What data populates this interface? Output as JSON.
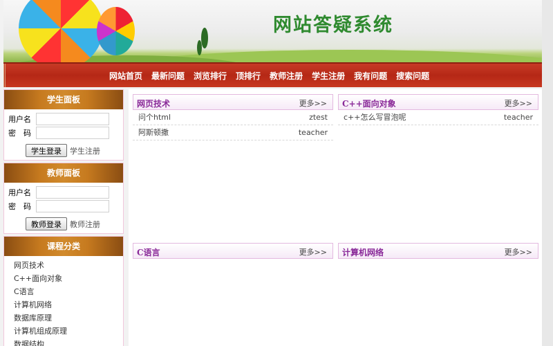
{
  "banner": {
    "title": "网站答疑系统"
  },
  "nav": {
    "items": [
      "网站首页",
      "最新问题",
      "浏览排行",
      "顶排行",
      "教师注册",
      "学生注册",
      "我有问题",
      "搜索问题"
    ]
  },
  "student_panel": {
    "title": "学生面板",
    "username_label": "用户名",
    "password_label": "密　码",
    "login_button": "学生登录",
    "register_link": "学生注册"
  },
  "teacher_panel": {
    "title": "教师面板",
    "username_label": "用户名",
    "password_label": "密　码",
    "login_button": "教师登录",
    "register_link": "教师注册"
  },
  "course_panel": {
    "title": "课程分类",
    "items": [
      "网页技术",
      "C++面向对象",
      "C语言",
      "计算机网络",
      "数据库原理",
      "计算机组成原理",
      "数据结构"
    ]
  },
  "sections": {
    "web": {
      "title": "网页技术",
      "more": "更多>>",
      "questions": [
        {
          "title": "问个html",
          "user": "ztest"
        },
        {
          "title": "阿斯顿撒",
          "user": "teacher"
        }
      ]
    },
    "cpp": {
      "title": "C++面向对象",
      "more": "更多>>",
      "questions": [
        {
          "title": "c++怎么写冒泡呢",
          "user": "teacher"
        }
      ]
    },
    "c": {
      "title": "C语言",
      "more": "更多>>"
    },
    "net": {
      "title": "计算机网络",
      "more": "更多>>"
    }
  }
}
